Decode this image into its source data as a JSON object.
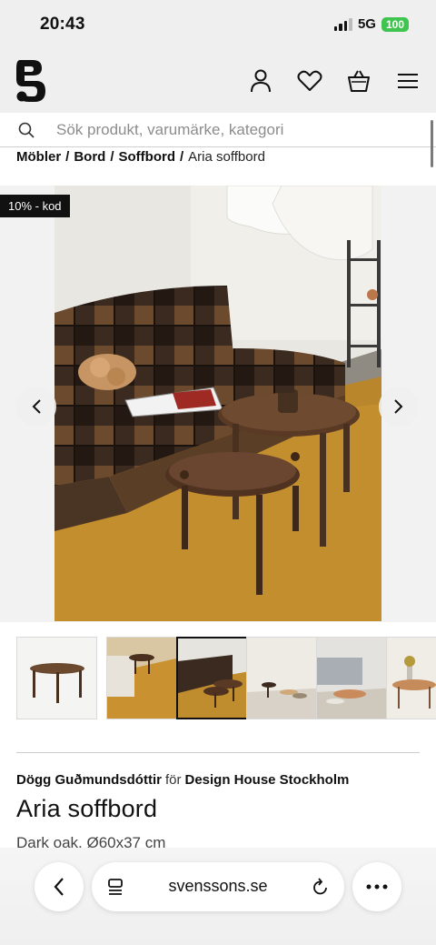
{
  "status": {
    "time": "20:43",
    "network": "5G",
    "battery": "100"
  },
  "header": {
    "logo": "svenssons-logo",
    "icons": [
      "account-icon",
      "heart-icon",
      "basket-icon",
      "menu-icon"
    ]
  },
  "search": {
    "placeholder": "Sök produkt, varumärke, kategori"
  },
  "breadcrumb": {
    "items": [
      "Möbler",
      "Bord",
      "Soffbord"
    ],
    "separator": "/",
    "current": "Aria soffbord"
  },
  "gallery": {
    "promo": "10% - kod"
  },
  "product": {
    "designer": "Dögg Guðmundsdóttir",
    "for": "för",
    "brand": "Design House Stockholm",
    "name": "Aria soffbord",
    "variant": "Dark oak, Ø60x37 cm"
  },
  "browser": {
    "url": "svenssons.se"
  },
  "colors": {
    "accent": "#111111",
    "battery": "#3ec44f",
    "background": "#efefef"
  }
}
